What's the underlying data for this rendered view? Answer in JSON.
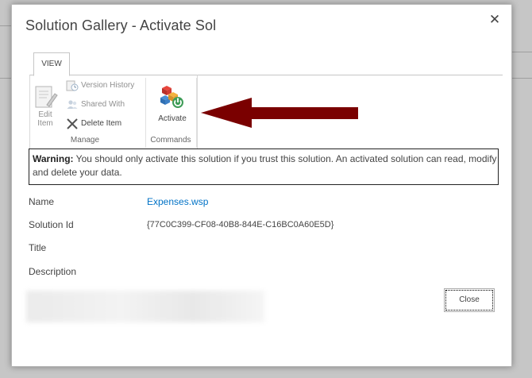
{
  "dialog": {
    "title": "Solution Gallery - Activate Sol",
    "close_glyph": "✕"
  },
  "ribbon": {
    "tab_label": "VIEW",
    "manage": {
      "edit_item_label": "Edit\nItem",
      "version_history_label": "Version History",
      "shared_with_label": "Shared With",
      "delete_item_label": "Delete Item",
      "group_label": "Manage"
    },
    "commands": {
      "activate_label": "Activate",
      "group_label": "Commands"
    }
  },
  "warning": {
    "prefix": "Warning:",
    "text": " You should only activate this solution if you trust this solution. An activated solution can read, modify and delete your data."
  },
  "properties": {
    "name_label": "Name",
    "name_value": "Expenses.wsp",
    "solution_id_label": "Solution Id",
    "solution_id_value": "{77C0C399-CF08-40B8-844E-C16BC0A60E5D}",
    "title_label": "Title",
    "description_label": "Description"
  },
  "footer": {
    "close_label": "Close"
  },
  "colors": {
    "accent": "#0072c6",
    "arrow": "#7a0000"
  }
}
